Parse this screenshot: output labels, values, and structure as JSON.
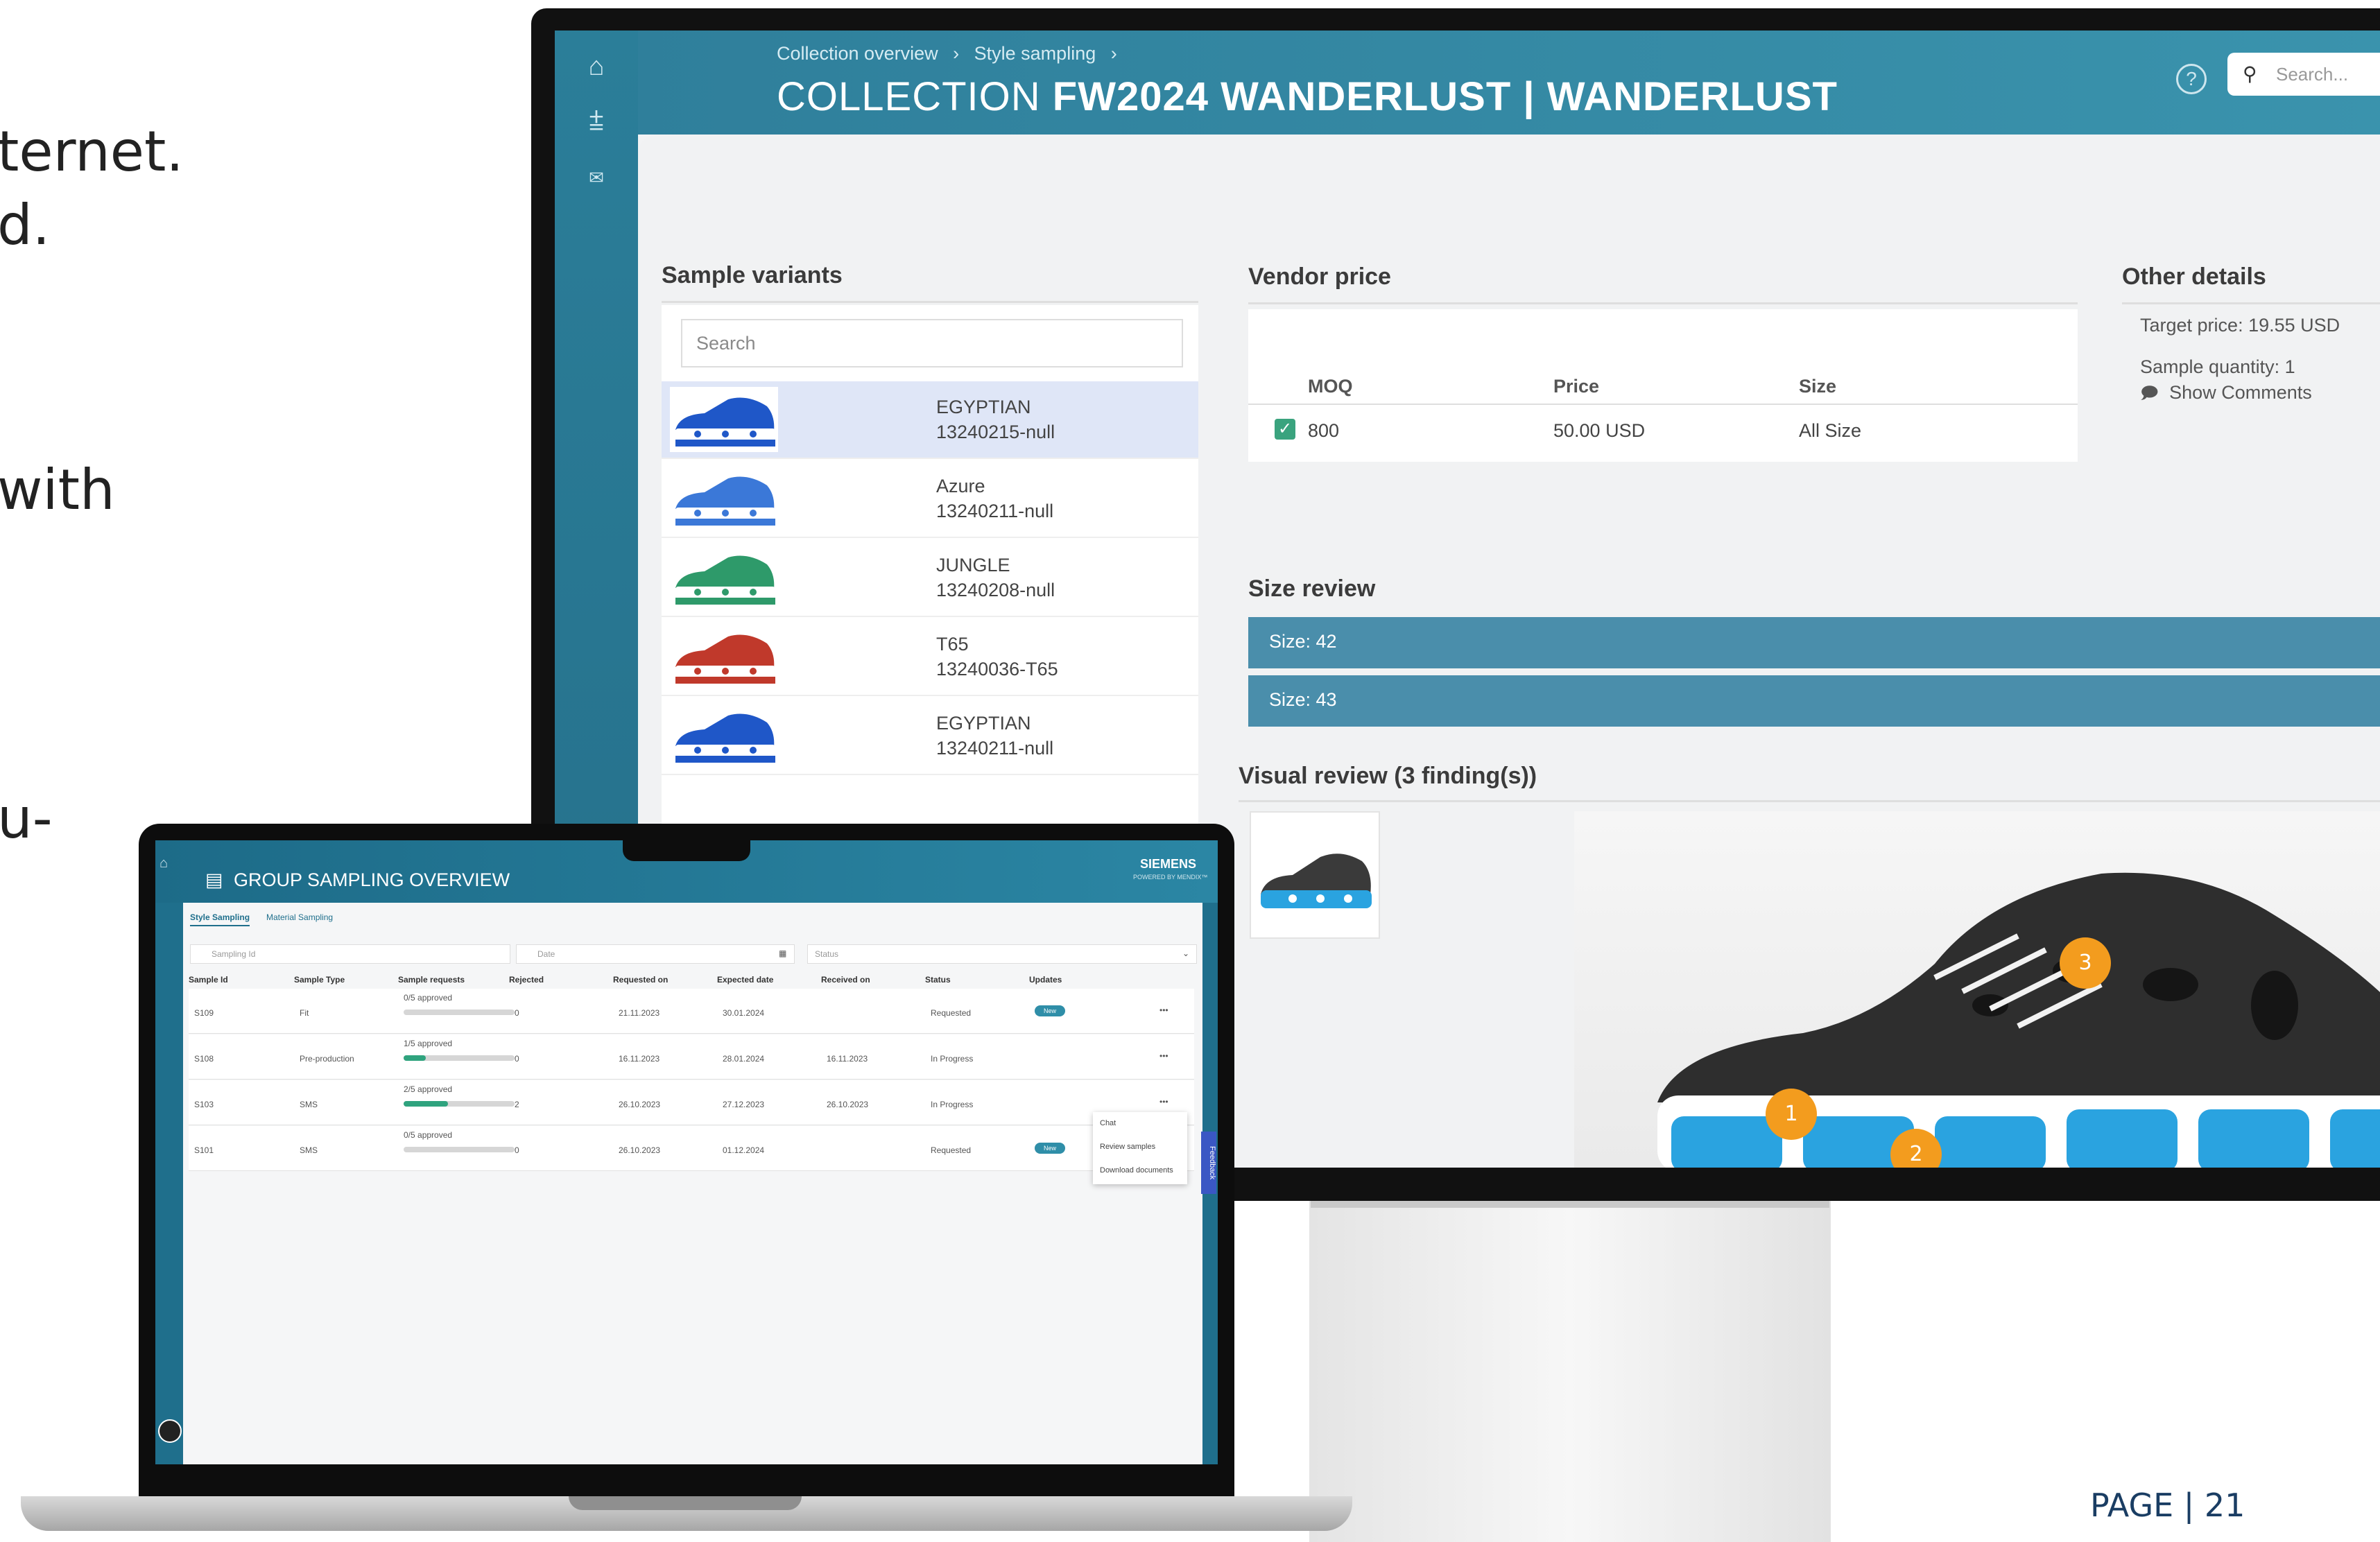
{
  "slide": {
    "text_lines": [
      "ternet.",
      "d.",
      "with",
      "u-"
    ],
    "page_label": "PAGE | 21"
  },
  "monitor": {
    "breadcrumb": [
      "Collection overview",
      "Style sampling"
    ],
    "breadcrumb_sep": "›",
    "title_prefix": "COLLECTION",
    "title": "FW2024 WANDERLUST | WANDERLUST",
    "search_placeholder": "Search...",
    "sample_variants": {
      "title": "Sample variants",
      "search_placeholder": "Search",
      "items": [
        {
          "name": "EGYPTIAN",
          "code": "13240215-null",
          "color": "#1f57c8",
          "selected": true
        },
        {
          "name": "Azure",
          "code": "13240211-null",
          "color": "#3b78d8",
          "selected": false
        },
        {
          "name": "JUNGLE",
          "code": "13240208-null",
          "color": "#2e9a6a",
          "selected": false
        },
        {
          "name": "T65",
          "code": "13240036-T65",
          "color": "#c0392b",
          "selected": false
        },
        {
          "name": "EGYPTIAN",
          "code": "13240211-null",
          "color": "#1f57c8",
          "selected": false
        }
      ]
    },
    "vendor_price": {
      "title": "Vendor price",
      "headers": [
        "MOQ",
        "Price",
        "Size"
      ],
      "row": {
        "moq": "800",
        "price": "50.00 USD",
        "size": "All Size"
      }
    },
    "other_details": {
      "title": "Other details",
      "target_price": "Target price: 19.55 USD",
      "sample_quantity": "Sample quantity: 1",
      "show_comments": "Show Comments"
    },
    "size_review": {
      "title": "Size review",
      "sizes": [
        "Size: 42",
        "Size: 43"
      ]
    },
    "visual_review": {
      "title": "Visual review (3 finding(s))",
      "findings": [
        "1",
        "2",
        "3"
      ]
    }
  },
  "laptop": {
    "title": "GROUP SAMPLING OVERVIEW",
    "brand": "SIEMENS",
    "brand_sub": "POWERED BY MENDIX™",
    "tabs": [
      "Style Sampling",
      "Material Sampling"
    ],
    "filters": {
      "sampling_id": "Sampling Id",
      "date": "Date",
      "status": "Status"
    },
    "columns": [
      "Sample Id",
      "Sample Type",
      "Sample requests",
      "Rejected",
      "Requested on",
      "Expected date",
      "Received on",
      "Status",
      "Updates"
    ],
    "rows": [
      {
        "id": "S109",
        "type": "Fit",
        "requests": "0/5 approved",
        "progress": 0,
        "rejected": "0",
        "requested": "21.11.2023",
        "expected": "30.01.2024",
        "received": "",
        "status": "Requested",
        "badge": "New"
      },
      {
        "id": "S108",
        "type": "Pre-production",
        "requests": "1/5 approved",
        "progress": 0.2,
        "rejected": "0",
        "requested": "16.11.2023",
        "expected": "28.01.2024",
        "received": "16.11.2023",
        "status": "In Progress",
        "badge": ""
      },
      {
        "id": "S103",
        "type": "SMS",
        "requests": "2/5 approved",
        "progress": 0.4,
        "rejected": "2",
        "requested": "26.10.2023",
        "expected": "27.12.2023",
        "received": "26.10.2023",
        "status": "In Progress",
        "badge": ""
      },
      {
        "id": "S101",
        "type": "SMS",
        "requests": "0/5 approved",
        "progress": 0,
        "rejected": "0",
        "requested": "26.10.2023",
        "expected": "01.12.2024",
        "received": "",
        "status": "Requested",
        "badge": "New"
      }
    ],
    "context_menu": [
      "Chat",
      "Review samples",
      "Download documents"
    ],
    "feedback": "Feedback",
    "more": "•••"
  },
  "icons": [
    "home-icon",
    "add-layers-icon",
    "mail-icon",
    "help-icon",
    "search-icon",
    "comment-icon",
    "checkbox-icon",
    "calendar-icon",
    "sort-icon",
    "chevron-down-icon",
    "avatar-icon"
  ],
  "colors": {
    "header": "#2f7f9b",
    "accent": "#4a8eab",
    "finding": "#f39c1e",
    "approved": "#2fa37e"
  }
}
